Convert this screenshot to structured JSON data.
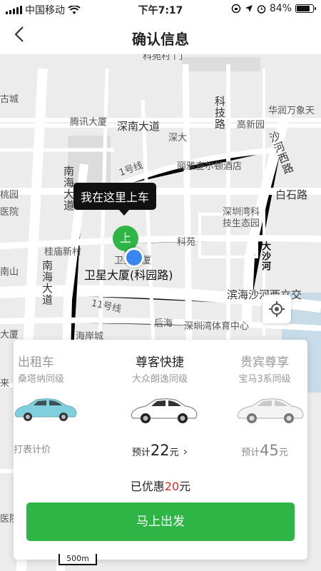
{
  "status_bar": {
    "carrier": "中国移动",
    "time": "下午7:17",
    "battery_percent": "84%",
    "battery_level": 0.84,
    "icons": [
      "signal-icon",
      "wifi-icon",
      "rotation-lock-icon",
      "location-arrow-icon",
      "alarm-icon",
      "battery-icon"
    ]
  },
  "header": {
    "title": "确认信息",
    "back_icon": "chevron-left-icon"
  },
  "map": {
    "labels": {
      "top_cut": "科苑村 门",
      "gucheng": "古城",
      "kejilu": "科技路",
      "huarun": "华润万象天",
      "tengxun": "腾讯大厦",
      "shennan": "深南大道",
      "gaoxin": "高新园",
      "shenda": "深大",
      "shahe_w": "沙河西路",
      "line1": "1号线",
      "liyacha": "丽雅查尔顿酒店",
      "nanhai_top": "南海大道",
      "taoyuan": "桃园",
      "baishi": "白石路",
      "yiyuan": "医院",
      "shenzhenwan": "深圳湾科技生态园",
      "keyuan": "科苑",
      "guixin": "桂庙新村",
      "dashahe": "大沙河",
      "weixing_small": "卫星大厦",
      "weixing": "卫星大厦(科园路)",
      "nanshan": "南山",
      "nanhai_bot": "南海大道",
      "binhai": "滨海沙河西立交",
      "line11": "11号线",
      "houhai": "后海",
      "tiyu": "深圳湾体育中心",
      "haian": "海岸城",
      "left_da": "大厦",
      "left_lai": "来",
      "left_yiyuan": "医院"
    },
    "callout": "我在这里上车",
    "pickup_pin": "上",
    "locate_icon": "crosshair-icon",
    "scale": "500m"
  },
  "options": [
    {
      "name": "出租车",
      "sub": "桑塔纳同级",
      "price": "打表计价",
      "car_color": "#7fd0dc",
      "selected": false
    },
    {
      "name": "尊客快捷",
      "sub": "大众朗逸同级",
      "price_prefix": "预计",
      "price_value": "22",
      "price_unit": "元",
      "car_color": "#ffffff",
      "selected": true
    },
    {
      "name": "贵宾尊享",
      "sub": "宝马3系同级",
      "price_prefix": "预计",
      "price_value": "45",
      "price_unit": "元",
      "car_color": "#f4f4f4",
      "selected": false
    }
  ],
  "discount": {
    "prefix": "已优惠",
    "amount": "20",
    "unit": "元"
  },
  "go_button": "马上出发",
  "colors": {
    "brand_green": "#2fb446",
    "discount_red": "#e02a2a",
    "location_blue": "#3a86f0"
  }
}
